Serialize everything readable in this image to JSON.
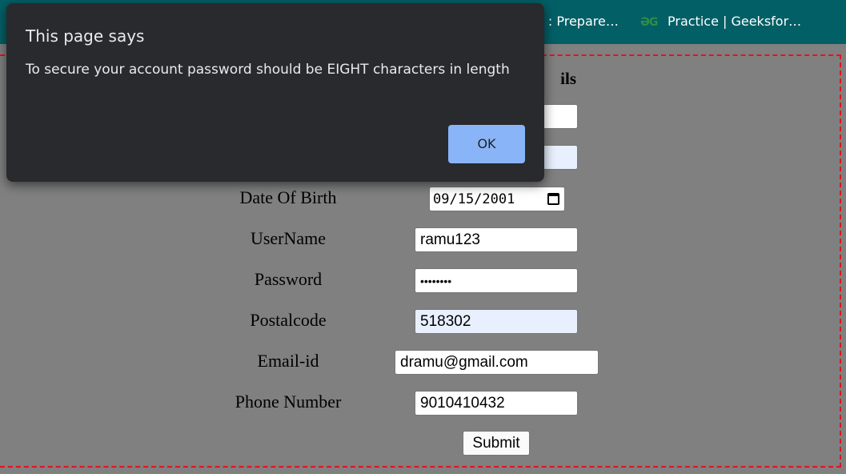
{
  "bookmarks": [
    {
      "label": "a : Prepare…"
    },
    {
      "icon": "gfg-icon",
      "label": "Practice | Geeksfor…"
    }
  ],
  "form": {
    "heading_partial": "ils",
    "fields": [
      {
        "label": "Date Of Birth",
        "value": "09/15/2001",
        "type": "date"
      },
      {
        "label": "UserName",
        "value": "ramu123"
      },
      {
        "label": "Password",
        "value": "••••••••",
        "type": "password"
      },
      {
        "label": "Postalcode",
        "value": "518302",
        "autofill": true
      },
      {
        "label": "Email-id",
        "value": "dramu@gmail.com"
      },
      {
        "label": "Phone Number",
        "value": "9010410432"
      }
    ],
    "submit_label": "Submit"
  },
  "dialog": {
    "title": "This page says",
    "message": "To secure your account password should be EIGHT characters in length",
    "ok_label": "OK"
  },
  "colors": {
    "bookmarks_bg": "#035f66",
    "page_bg": "#808080",
    "frame_border": "#e0141e",
    "dialog_bg": "#292a2d",
    "ok_button": "#8ab4f8",
    "autofill_bg": "#e8f0fe"
  }
}
